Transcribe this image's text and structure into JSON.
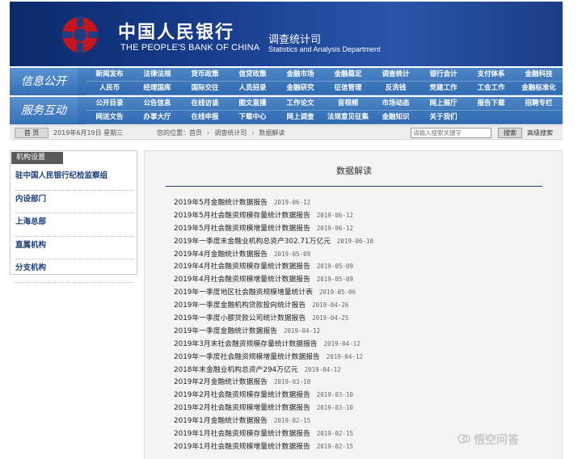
{
  "header": {
    "bank_name_cn": "中国人民银行",
    "bank_name_en": "THE PEOPLE'S BANK OF CHINA",
    "dept_cn": "调查统计司",
    "dept_en": "Statistics and Analysis Department",
    "logo_icon": "pboc-logo-icon",
    "brand_color": "#c4161c"
  },
  "nav": {
    "row1_title": "信息公开",
    "row1_items": [
      "新闻发布",
      "法律法规",
      "货币政策",
      "信贷政策",
      "金融市场",
      "金融稳定",
      "调查统计",
      "银行会计",
      "支付体系",
      "金融科技",
      "人民币",
      "经理国库",
      "国际交往",
      "人员招录",
      "金融研究",
      "征信管理",
      "反洗钱",
      "党建工作",
      "工会工作",
      "金融标准化"
    ],
    "row2_title": "服务互动",
    "row2_items": [
      "公开目录",
      "公告信息",
      "在线访谈",
      "图文直播",
      "工作论文",
      "音视频",
      "市场动态",
      "网上展厅",
      "报告下载",
      "招聘专栏",
      "网送文告",
      "办事大厅",
      "在线申报",
      "下载中心",
      "网上调查",
      "法规意见征集",
      "金融知识",
      "关于我们",
      "",
      ""
    ]
  },
  "strip": {
    "home_label": "首 页",
    "date": "2019年6月19日 星期三",
    "breadcrumb_prefix": "您的位置：",
    "breadcrumb": [
      "首页",
      "调查统计司",
      "数据解读"
    ],
    "search_placeholder": "请输入搜索关键字",
    "search_button": "搜索",
    "advanced_search": "高级搜索"
  },
  "sidebar": {
    "heading": "机构设置",
    "items": [
      "驻中国人民银行纪检监察组",
      "内设部门",
      "上海总部",
      "直属机构",
      "分支机构"
    ]
  },
  "main": {
    "title": "数据解读",
    "articles": [
      {
        "title": "2019年5月金融统计数据报告",
        "date": "2019-06-12"
      },
      {
        "title": "2019年5月社会融资规模存量统计数据报告",
        "date": "2019-06-12"
      },
      {
        "title": "2019年5月社会融资规模增量统计数据报告",
        "date": "2019-06-12"
      },
      {
        "title": "2019年一季度末金融业机构总资产302.71万亿元",
        "date": "2019-06-10"
      },
      {
        "title": "2019年4月金融统计数据报告",
        "date": "2019-05-09"
      },
      {
        "title": "2019年4月社会融资规模存量统计数据报告",
        "date": "2019-05-09"
      },
      {
        "title": "2019年4月社会融资规模增量统计数据报告",
        "date": "2019-05-09"
      },
      {
        "title": "2019年一季度地区社会融资规模增量统计表",
        "date": "2019-05-06"
      },
      {
        "title": "2019年一季度金融机构贷款投向统计报告",
        "date": "2019-04-26"
      },
      {
        "title": "2019年一季度小额贷款公司统计数据报告",
        "date": "2019-04-25"
      },
      {
        "title": "2019年一季度金融统计数据报告",
        "date": "2019-04-12"
      },
      {
        "title": "2019年3月末社会融资规模存量统计数据报告",
        "date": "2019-04-12"
      },
      {
        "title": "2019年一季度社会融资规模增量统计数据报告",
        "date": "2019-04-12"
      },
      {
        "title": "2018年末金融业机构总资产294万亿元",
        "date": "2019-04-12"
      },
      {
        "title": "2019年2月金融统计数据报告",
        "date": "2019-03-10"
      },
      {
        "title": "2019年2月社会融资规模存量统计数据报告",
        "date": "2019-03-10"
      },
      {
        "title": "2019年2月社会融资规模增量统计数据报告",
        "date": "2019-03-10"
      },
      {
        "title": "2019年1月金融统计数据报告",
        "date": "2019-02-15"
      },
      {
        "title": "2019年1月社会融资规模存量统计数据报告",
        "date": "2019-02-15"
      },
      {
        "title": "2019年1月社会融资规模增量统计数据报告",
        "date": "2019-02-15"
      }
    ]
  },
  "watermark": {
    "text": "悟空问答",
    "icon": "wukong-logo-icon"
  }
}
